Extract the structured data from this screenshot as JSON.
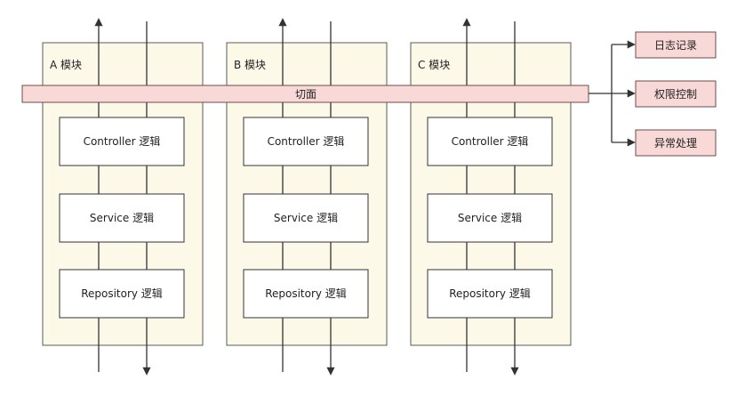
{
  "modules": [
    {
      "title": "A 模块",
      "layers": [
        "Controller 逻辑",
        "Service 逻辑",
        "Repository 逻辑"
      ]
    },
    {
      "title": "B 模块",
      "layers": [
        "Controller 逻辑",
        "Service 逻辑",
        "Repository 逻辑"
      ]
    },
    {
      "title": "C 模块",
      "layers": [
        "Controller 逻辑",
        "Service 逻辑",
        "Repository 逻辑"
      ]
    }
  ],
  "aspect": {
    "label": "切面"
  },
  "concerns": [
    "日志记录",
    "权限控制",
    "异常处理"
  ],
  "colors": {
    "module_fill": "#fdf9e8",
    "aspect_fill": "#f8d9d8",
    "line": "#333333"
  }
}
